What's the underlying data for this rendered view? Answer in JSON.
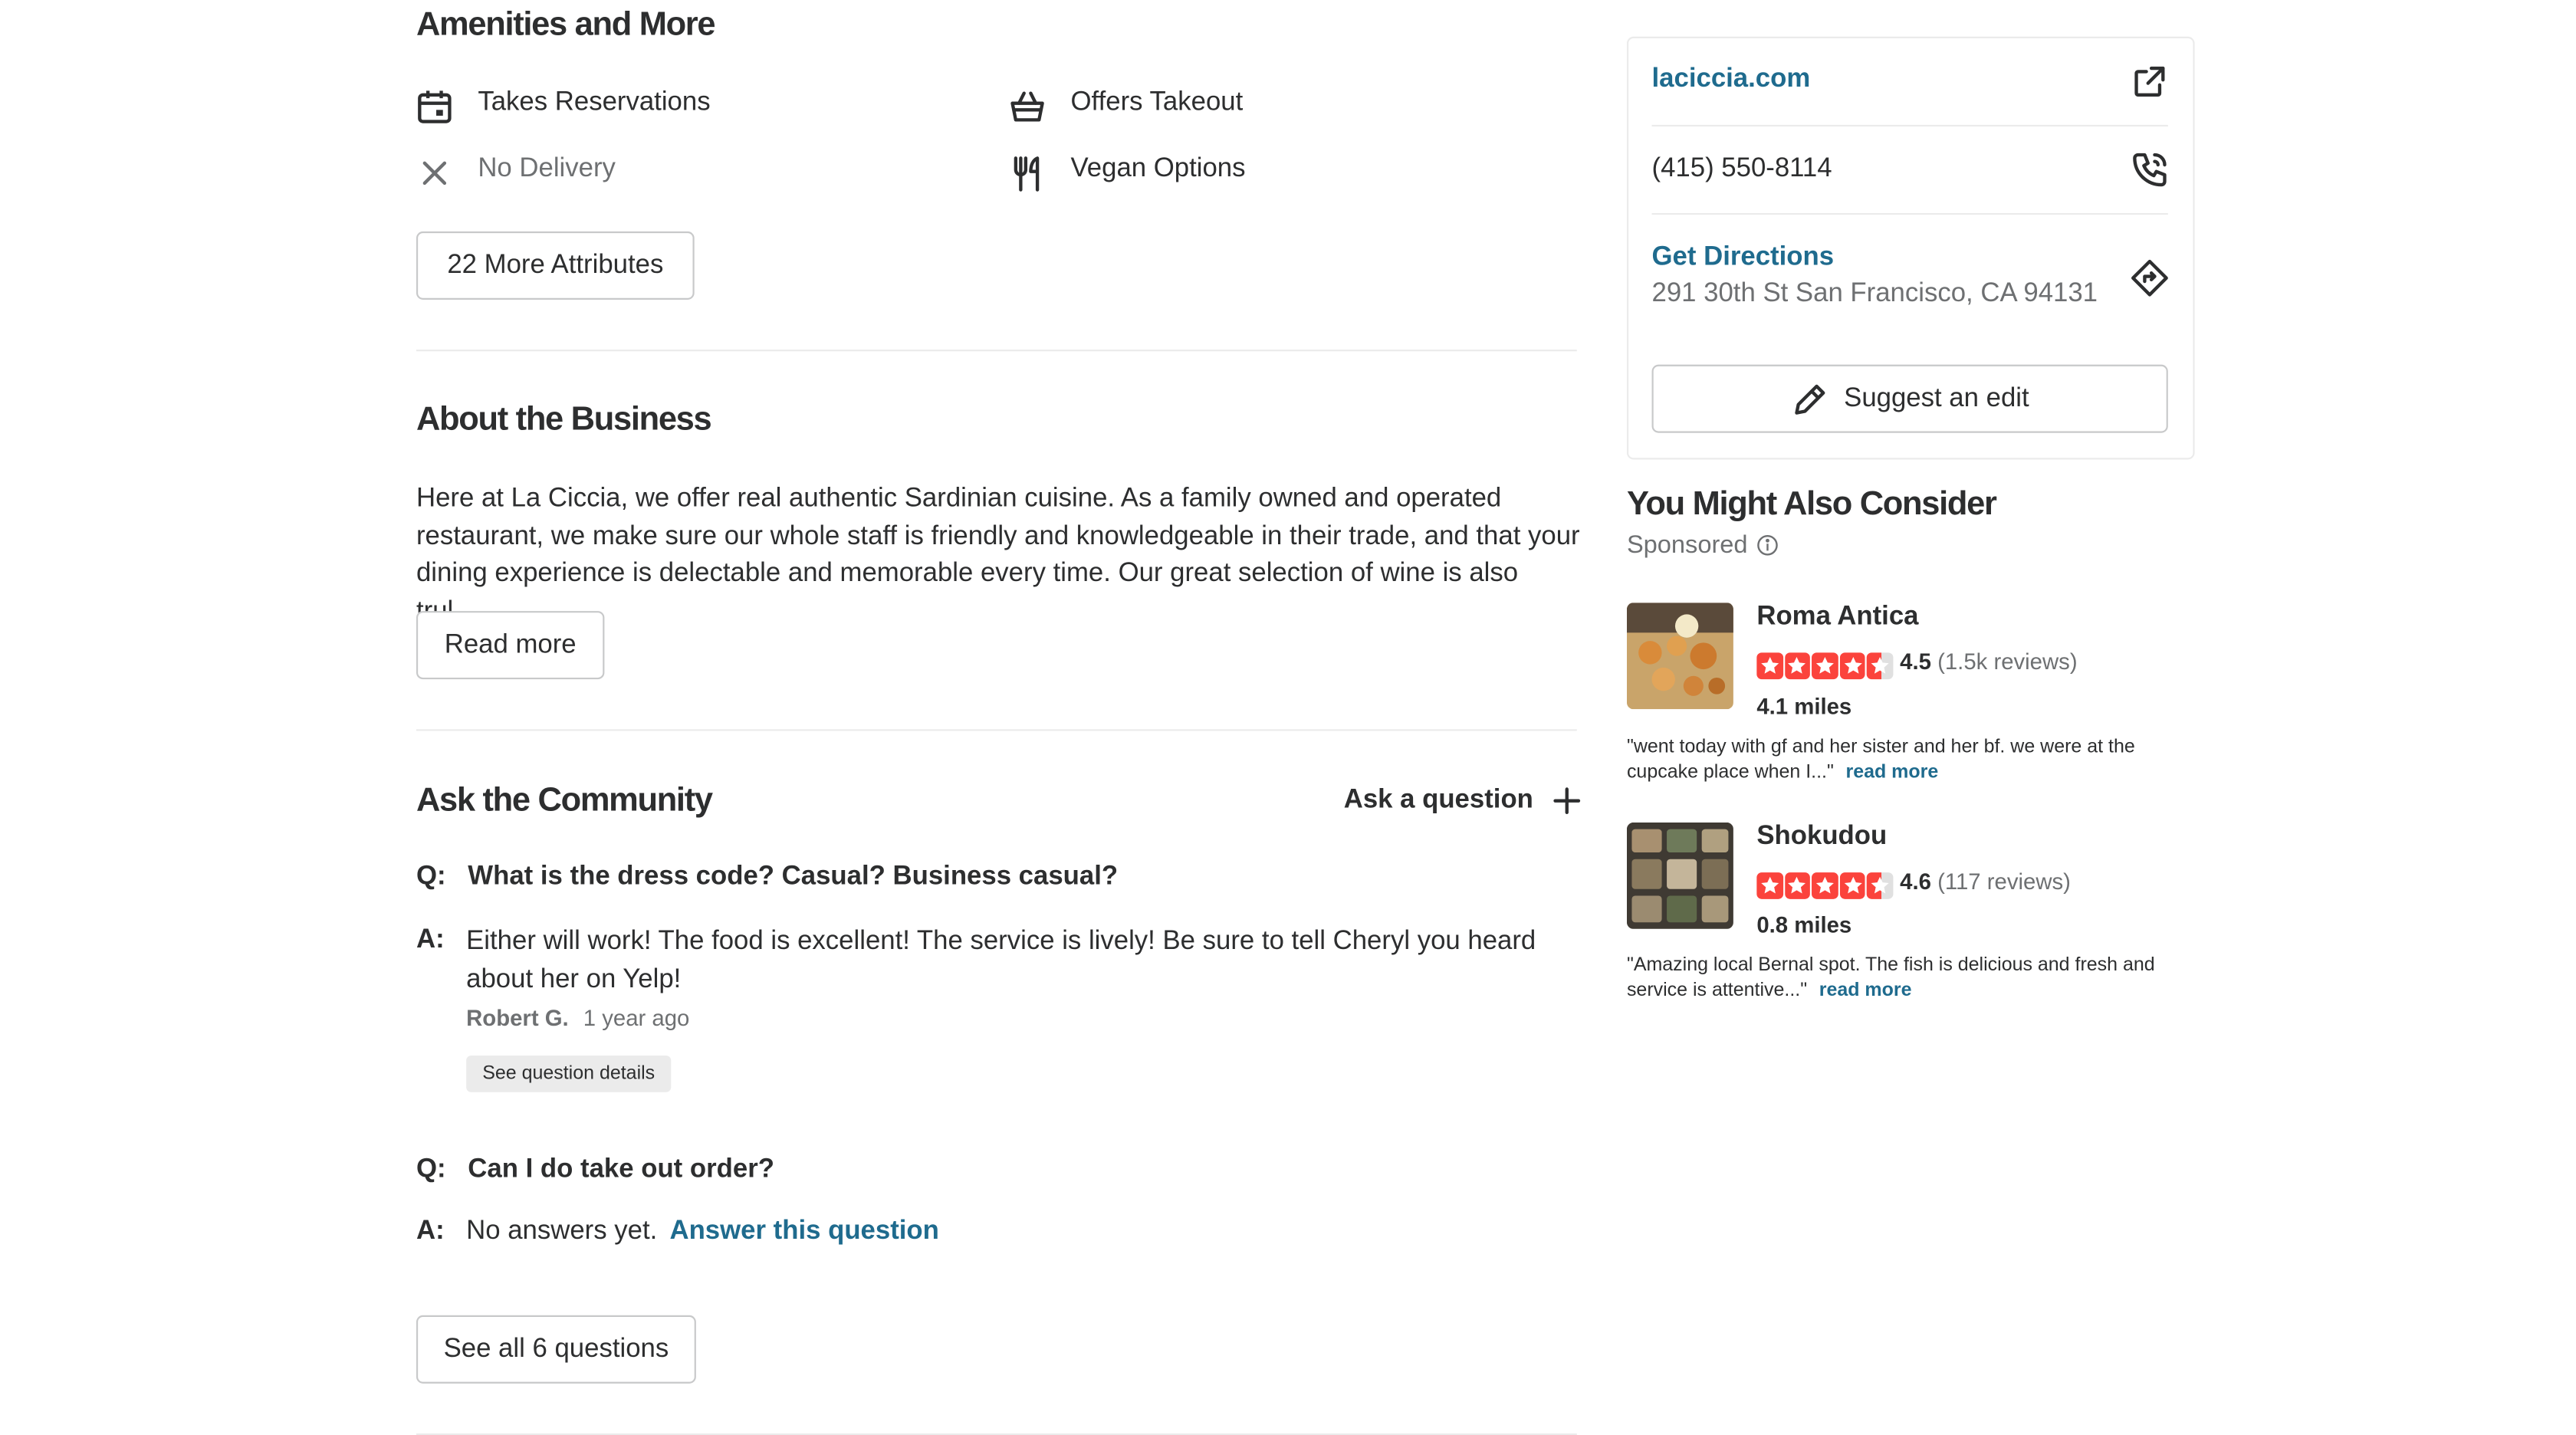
{
  "amenities": {
    "heading": "Amenities and More",
    "items": [
      {
        "label": "Takes Reservations",
        "icon": "calendar-icon",
        "available": true
      },
      {
        "label": "Offers Takeout",
        "icon": "takeout-basket-icon",
        "available": true
      },
      {
        "label": "No Delivery",
        "icon": "close-icon",
        "available": false
      },
      {
        "label": "Vegan Options",
        "icon": "utensils-icon",
        "available": true
      }
    ],
    "more_button": "22 More Attributes"
  },
  "about": {
    "heading": "About the Business",
    "text": "Here at La Ciccia, we offer real authentic Sardinian cuisine. As a family owned and operated restaurant, we make sure our whole staff is friendly and knowledgeable in their trade, and that your dining experience is delectable and memorable every time. Our great selection of wine is also trul...",
    "read_more": "Read more"
  },
  "community": {
    "heading": "Ask the Community",
    "ask_label": "Ask a question",
    "q_prefix": "Q:",
    "a_prefix": "A:",
    "questions": [
      {
        "question": "What is the dress code? Casual? Business casual?",
        "answer": "Either will work! The food is excellent! The service is lively! Be sure to tell Cheryl you heard about her on Yelp!",
        "author": "Robert G.",
        "time": "1 year ago",
        "details_button": "See question details"
      },
      {
        "question": "Can I do take out order?",
        "no_answer": "No answers yet.",
        "answer_link": "Answer this question"
      }
    ],
    "see_all": "See all 6 questions"
  },
  "sidebar": {
    "website": "laciccia.com",
    "phone": "(415) 550-8114",
    "directions_label": "Get Directions",
    "address": "291 30th St San Francisco, CA 94131",
    "suggest_edit": "Suggest an edit"
  },
  "consider": {
    "heading": "You Might Also Consider",
    "sponsored": "Sponsored",
    "listings": [
      {
        "name": "Roma Antica",
        "rating": "4.5",
        "rating_value": 4.5,
        "reviews": "(1.5k reviews)",
        "distance": "4.1 miles",
        "snippet": "\"went today with gf and her sister and her bf. we were at the cupcake place when I...\"",
        "read_more": "read more"
      },
      {
        "name": "Shokudou",
        "rating": "4.6",
        "rating_value": 4.6,
        "reviews": "(117 reviews)",
        "distance": "0.8 miles",
        "snippet": "\"Amazing local Bernal spot. The fish is delicious and fresh and service is attentive...\"",
        "read_more": "read more"
      }
    ]
  },
  "colors": {
    "link": "#1f6b8e",
    "star": "#fb433c",
    "text": "#2d2e2f",
    "muted": "#6e7072",
    "border": "#c8c9ca",
    "divider": "#ebebeb"
  }
}
